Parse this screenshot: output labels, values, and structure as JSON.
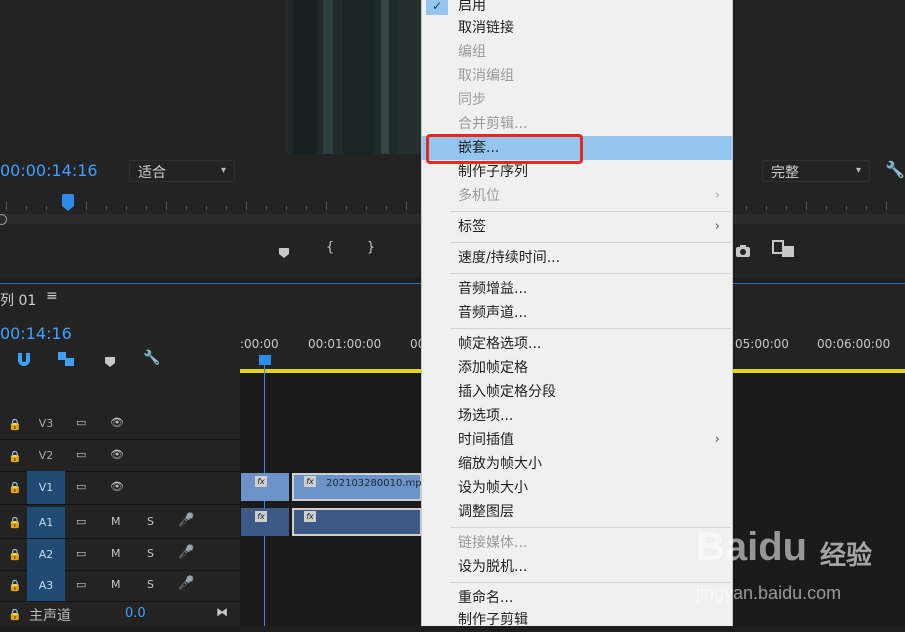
{
  "monitor": {
    "timecode": "00:00:14:16",
    "fit_select": "适合",
    "quality_select": "完整",
    "controls": [
      "{",
      "}"
    ]
  },
  "timeline": {
    "sequence_title": "列 01",
    "timecode": "00:14:16",
    "ruler_labels": [
      ":00:00",
      "00:01:00:00",
      "00:",
      "05:00:00",
      "00:06:00:00"
    ],
    "tracks": [
      {
        "name": "V3"
      },
      {
        "name": "V2"
      },
      {
        "name": "V1"
      },
      {
        "name": "A1"
      },
      {
        "name": "A2"
      },
      {
        "name": "A3"
      }
    ],
    "audio_m": "M",
    "audio_s": "S",
    "master_label": "主声道",
    "master_value": "0.0",
    "clip_name": "202103280010.mp4"
  },
  "menu": {
    "items": [
      {
        "label": "启用",
        "disabled": false,
        "checked": true
      },
      {
        "label": "取消链接",
        "disabled": false
      },
      {
        "label": "编组",
        "disabled": true
      },
      {
        "label": "取消编组",
        "disabled": true
      },
      {
        "label": "同步",
        "disabled": true
      },
      {
        "label": "合并剪辑...",
        "disabled": true
      },
      {
        "label": "嵌套...",
        "disabled": false,
        "highlighted": true
      },
      {
        "label": "制作子序列",
        "disabled": false
      },
      {
        "label": "多机位",
        "disabled": true,
        "submenu": true
      },
      {
        "label": "标签",
        "disabled": false,
        "submenu": true
      },
      {
        "label": "速度/持续时间...",
        "disabled": false
      },
      {
        "label": "音频增益...",
        "disabled": false
      },
      {
        "label": "音频声道...",
        "disabled": false
      },
      {
        "label": "帧定格选项...",
        "disabled": false
      },
      {
        "label": "添加帧定格",
        "disabled": false
      },
      {
        "label": "插入帧定格分段",
        "disabled": false
      },
      {
        "label": "场选项...",
        "disabled": false
      },
      {
        "label": "时间插值",
        "disabled": false,
        "submenu": true
      },
      {
        "label": "缩放为帧大小",
        "disabled": false
      },
      {
        "label": "设为帧大小",
        "disabled": false
      },
      {
        "label": "调整图层",
        "disabled": false
      },
      {
        "label": "链接媒体...",
        "disabled": true
      },
      {
        "label": "设为脱机...",
        "disabled": false
      },
      {
        "label": "重命名...",
        "disabled": false
      },
      {
        "label": "制作子剪辑",
        "disabled": false
      }
    ]
  },
  "watermark": {
    "brand": "Baidu",
    "brand_cn": "经验",
    "url": "jingyan.baidu.com"
  },
  "colors": {
    "accent_blue": "#3ea1ff",
    "menu_highlight": "#93c5ef",
    "annotation_red": "#e8271f",
    "track_selected": "#1f4b75",
    "clip_video": "#6b93c8",
    "clip_audio": "#3c5a85"
  }
}
